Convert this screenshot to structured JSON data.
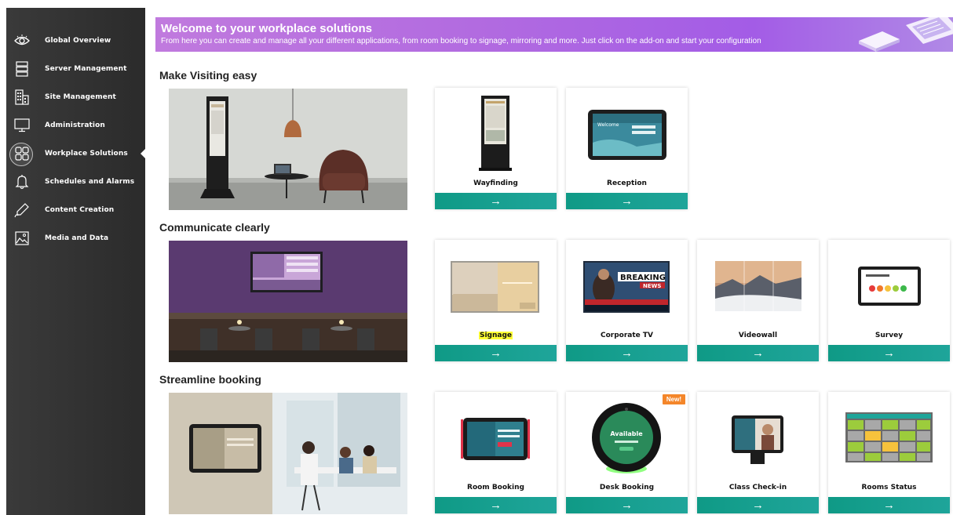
{
  "sidebar": {
    "items": [
      {
        "label": "Global Overview",
        "icon": "eye-icon"
      },
      {
        "label": "Server Management",
        "icon": "server-icon"
      },
      {
        "label": "Site Management",
        "icon": "building-icon"
      },
      {
        "label": "Administration",
        "icon": "monitor-icon"
      },
      {
        "label": "Workplace Solutions",
        "icon": "grid-icon",
        "active": true
      },
      {
        "label": "Schedules and Alarms",
        "icon": "bell-icon"
      },
      {
        "label": "Content Creation",
        "icon": "pen-icon"
      },
      {
        "label": "Media and Data",
        "icon": "image-icon"
      }
    ]
  },
  "banner": {
    "title": "Welcome to your workplace solutions",
    "subtitle": "From here you can create and manage all your different applications, from room booking to signage, mirroring and more. Just click on the add-on and start your configuration"
  },
  "sections": [
    {
      "title": "Make Visiting easy",
      "cards": [
        {
          "label": "Wayfinding"
        },
        {
          "label": "Reception"
        }
      ]
    },
    {
      "title": "Communicate clearly",
      "cards": [
        {
          "label": "Signage",
          "highlighted": true
        },
        {
          "label": "Corporate TV"
        },
        {
          "label": "Videowall"
        },
        {
          "label": "Survey"
        }
      ]
    },
    {
      "title": "Streamline booking",
      "cards": [
        {
          "label": "Room Booking"
        },
        {
          "label": "Desk Booking",
          "badge": "New!"
        },
        {
          "label": "Class Check-in"
        },
        {
          "label": "Rooms Status"
        }
      ]
    }
  ],
  "card_arrow": "→",
  "thumb_text": {
    "breaking": "BREAKING",
    "news": "NEWS",
    "available": "Available",
    "reception_screen": "Welcome"
  },
  "colors": {
    "accent": "#1fa59a",
    "sidebar": "#2e2e2e",
    "banner": "#b26be0",
    "badge": "#f4862a",
    "highlight": "#ffff33"
  }
}
